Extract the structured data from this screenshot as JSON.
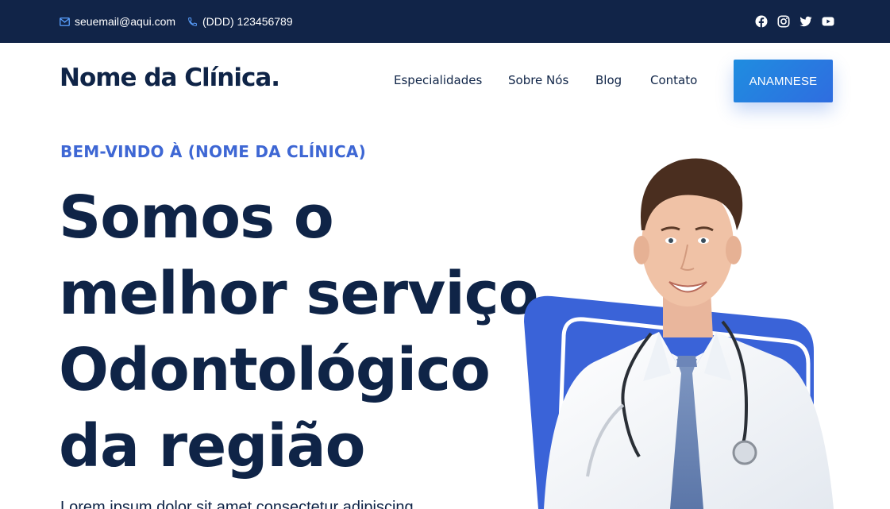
{
  "topbar": {
    "email": "seuemail@aqui.com",
    "phone": "(DDD) 123456789",
    "socials": [
      "facebook-icon",
      "instagram-icon",
      "twitter-icon",
      "youtube-icon"
    ],
    "background": "#112448"
  },
  "header": {
    "brand": "Nome da Clínica.",
    "nav": [
      "Especialidades",
      "Sobre Nós",
      "Blog",
      "Contato"
    ],
    "cta_label": "ANAMNESE"
  },
  "hero": {
    "eyebrow": "BEM-VINDO À (NOME DA CLÍNICA)",
    "headline_lines": [
      "Somos o",
      "melhor serviço",
      "Odontológico",
      "da região"
    ],
    "subtext": "Lorem ipsum dolor sit amet consectetur adipiscing"
  },
  "colors": {
    "navy": "#0f2447",
    "accent": "#3e67d4",
    "cta_gradient_start": "#1f8de0",
    "cta_gradient_end": "#2f6de0"
  }
}
